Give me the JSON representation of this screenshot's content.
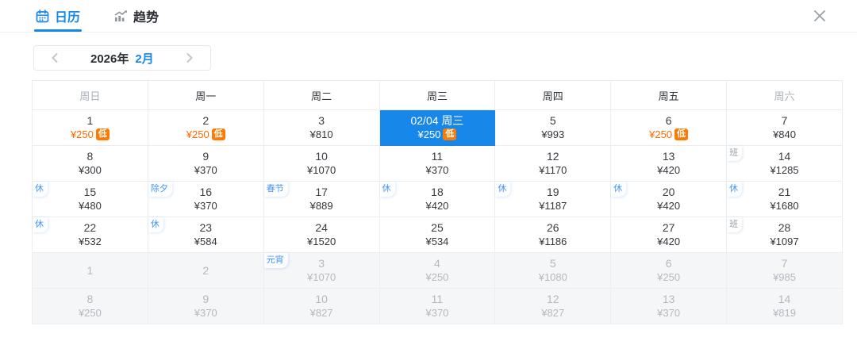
{
  "tabs": [
    {
      "label": "日历",
      "icon": "calendar-icon",
      "active": true
    },
    {
      "label": "趋势",
      "icon": "trend-icon",
      "active": false
    }
  ],
  "icons": {
    "close": "close-icon",
    "prev": "chevron-left-icon",
    "next": "chevron-right-icon"
  },
  "month_nav": {
    "year": "2026年",
    "month": "2月"
  },
  "badges": {
    "low": "低"
  },
  "colors": {
    "accent_blue": "#1787ea",
    "low_badge_orange": "#ff7a00",
    "low_price_orange": "#ff6a00",
    "muted_bg": "#f5f6f8",
    "holiday_badge_blue": "#4796f0",
    "work_badge_gray": "#9aa0a6"
  },
  "calendar": {
    "weekdays": [
      {
        "label": "周日",
        "weekend": true
      },
      {
        "label": "周一",
        "weekend": false
      },
      {
        "label": "周二",
        "weekend": false
      },
      {
        "label": "周三",
        "weekend": false
      },
      {
        "label": "周四",
        "weekend": false
      },
      {
        "label": "周五",
        "weekend": false
      },
      {
        "label": "周六",
        "weekend": true
      }
    ],
    "rows": [
      {
        "muted": false,
        "cells": [
          {
            "label": "1",
            "price": "¥250",
            "low": true
          },
          {
            "label": "2",
            "price": "¥250",
            "low": true
          },
          {
            "label": "3",
            "price": "¥810"
          },
          {
            "label": "02/04 周三",
            "price": "¥250",
            "low": true,
            "selected": true
          },
          {
            "label": "5",
            "price": "¥993"
          },
          {
            "label": "6",
            "price": "¥250",
            "low": true
          },
          {
            "label": "7",
            "price": "¥840"
          }
        ]
      },
      {
        "muted": false,
        "cells": [
          {
            "label": "8",
            "price": "¥300"
          },
          {
            "label": "9",
            "price": "¥370"
          },
          {
            "label": "10",
            "price": "¥1070"
          },
          {
            "label": "11",
            "price": "¥370"
          },
          {
            "label": "12",
            "price": "¥1170"
          },
          {
            "label": "13",
            "price": "¥420"
          },
          {
            "label": "14",
            "price": "¥1285",
            "badge": "班",
            "badge_type": "work"
          }
        ]
      },
      {
        "muted": false,
        "cells": [
          {
            "label": "15",
            "price": "¥480",
            "badge": "休",
            "badge_type": "rest"
          },
          {
            "label": "16",
            "price": "¥370",
            "badge": "除夕",
            "badge_type": "festival"
          },
          {
            "label": "17",
            "price": "¥889",
            "badge": "春节",
            "badge_type": "festival"
          },
          {
            "label": "18",
            "price": "¥420",
            "badge": "休",
            "badge_type": "rest"
          },
          {
            "label": "19",
            "price": "¥1187",
            "badge": "休",
            "badge_type": "rest"
          },
          {
            "label": "20",
            "price": "¥420",
            "badge": "休",
            "badge_type": "rest"
          },
          {
            "label": "21",
            "price": "¥1680",
            "badge": "休",
            "badge_type": "rest"
          }
        ]
      },
      {
        "muted": false,
        "cells": [
          {
            "label": "22",
            "price": "¥532",
            "badge": "休",
            "badge_type": "rest"
          },
          {
            "label": "23",
            "price": "¥584",
            "badge": "休",
            "badge_type": "rest"
          },
          {
            "label": "24",
            "price": "¥1520"
          },
          {
            "label": "25",
            "price": "¥534"
          },
          {
            "label": "26",
            "price": "¥1186"
          },
          {
            "label": "27",
            "price": "¥420"
          },
          {
            "label": "28",
            "price": "¥1097",
            "badge": "班",
            "badge_type": "work"
          }
        ]
      },
      {
        "muted": true,
        "cells": [
          {
            "label": "1",
            "price": ""
          },
          {
            "label": "2",
            "price": ""
          },
          {
            "label": "3",
            "price": "¥1070",
            "badge": "元宵",
            "badge_type": "festival"
          },
          {
            "label": "4",
            "price": "¥250"
          },
          {
            "label": "5",
            "price": "¥1080"
          },
          {
            "label": "6",
            "price": "¥250"
          },
          {
            "label": "7",
            "price": "¥985"
          }
        ]
      },
      {
        "muted": true,
        "cells": [
          {
            "label": "8",
            "price": "¥250"
          },
          {
            "label": "9",
            "price": "¥370"
          },
          {
            "label": "10",
            "price": "¥827"
          },
          {
            "label": "11",
            "price": "¥370"
          },
          {
            "label": "12",
            "price": "¥827"
          },
          {
            "label": "13",
            "price": "¥370"
          },
          {
            "label": "14",
            "price": "¥819"
          }
        ]
      }
    ]
  }
}
